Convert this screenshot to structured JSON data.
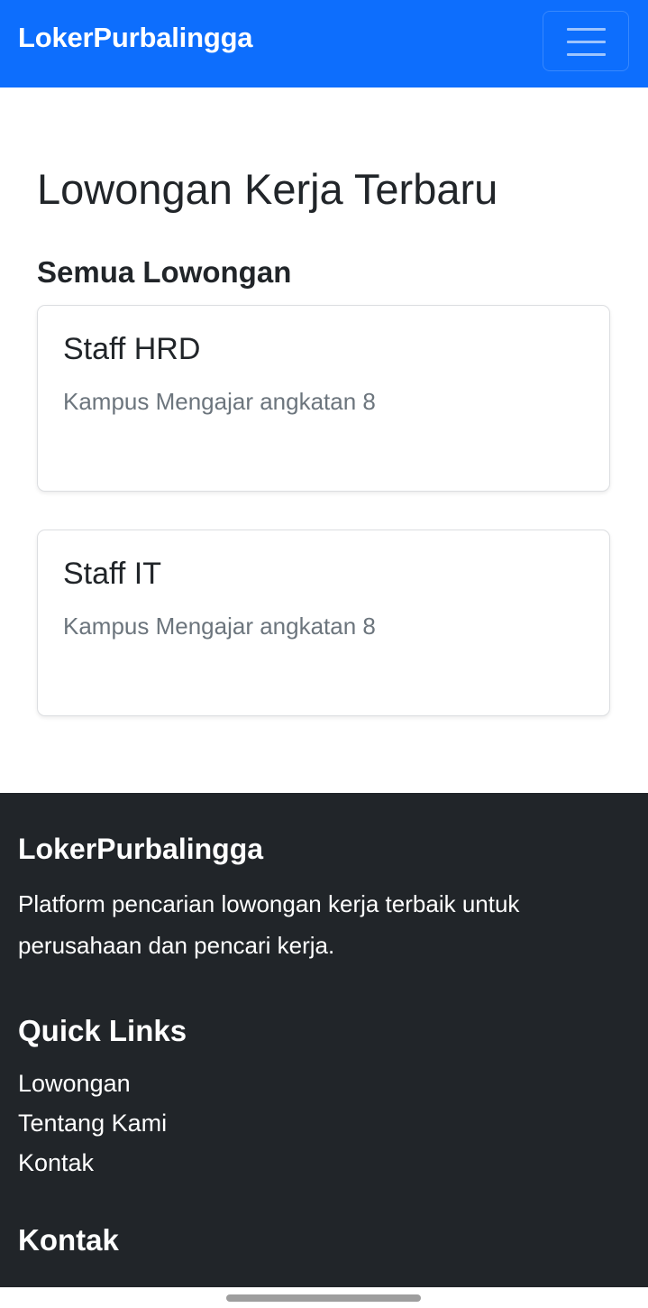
{
  "navbar": {
    "brand": "LokerPurbalingga",
    "menu_icon": "hamburger-menu-icon",
    "background_color": "#0d6efd"
  },
  "main": {
    "title": "Lowongan Kerja Terbaru",
    "section_title": "Semua Lowongan",
    "jobs": [
      {
        "title": "Staff HRD",
        "description": "Kampus Mengajar angkatan 8"
      },
      {
        "title": "Staff IT",
        "description": "Kampus Mengajar angkatan 8"
      }
    ]
  },
  "footer": {
    "brand": "LokerPurbalingga",
    "description": "Platform pencarian lowongan kerja terbaik untuk perusahaan dan pencari kerja.",
    "quick_links_title": "Quick Links",
    "quick_links": [
      "Lowongan",
      "Tentang Kami",
      "Kontak"
    ],
    "contact_title": "Kontak",
    "background_color": "#212529"
  }
}
